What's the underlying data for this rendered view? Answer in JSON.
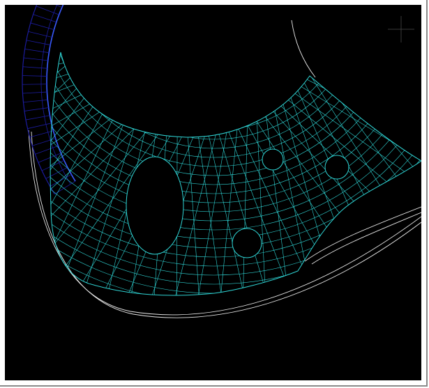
{
  "viewport": {
    "background": "#000000",
    "outline_color": "#e8e8e8",
    "mesh_color": "#2fd6d6",
    "shell_color": "#1c1c9e",
    "shell_edge_color": "#3a5bff",
    "cursor_icon": "crosshair-icon"
  }
}
